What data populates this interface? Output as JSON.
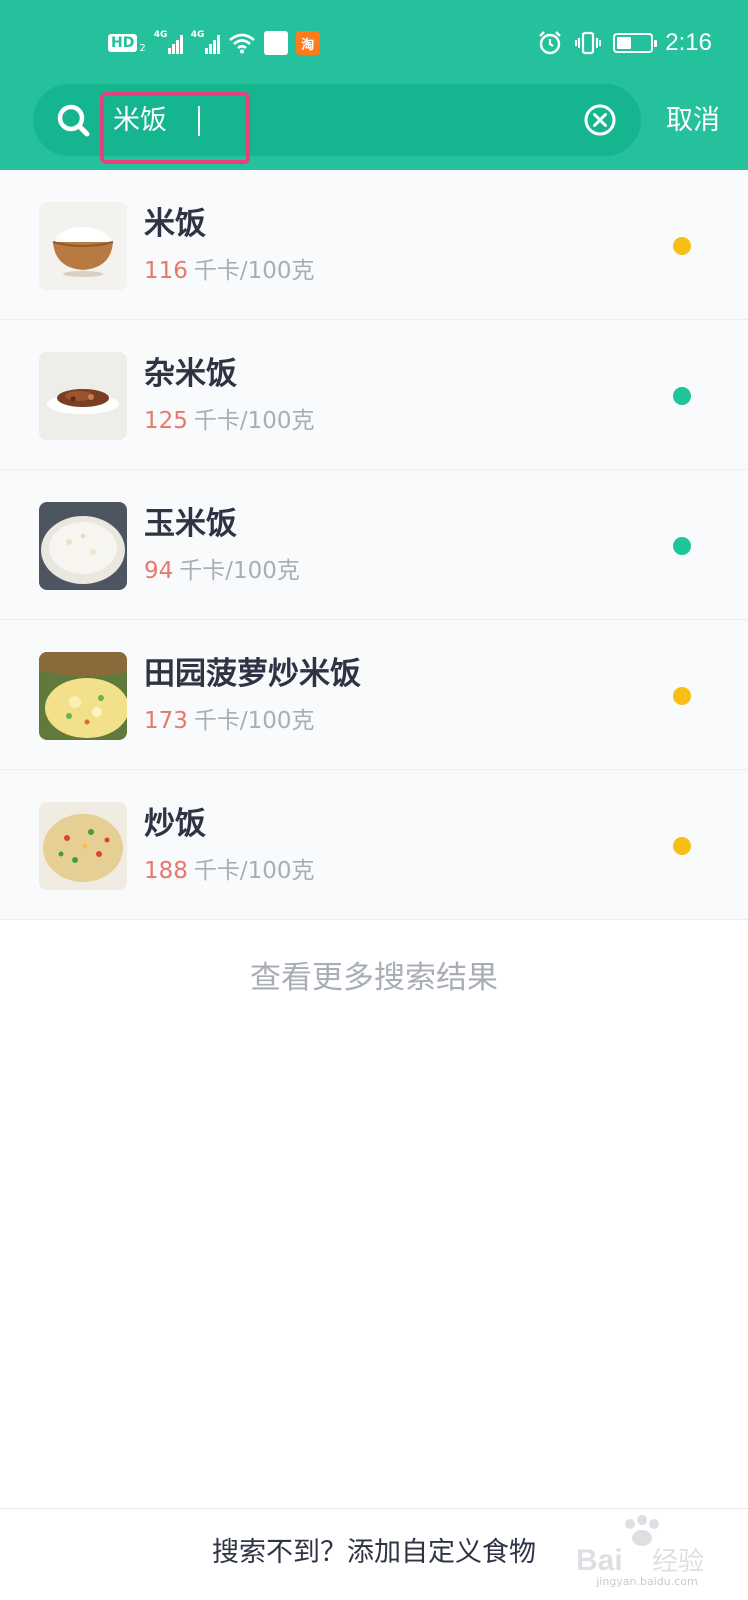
{
  "status_bar": {
    "hd_label": "HD",
    "hd_sub": "2",
    "network_1": "4G",
    "network_2": "4G",
    "app_icon_a": "",
    "app_icon_b": "淘",
    "time": "2:16"
  },
  "search": {
    "query": "米饭",
    "cancel_label": "取消"
  },
  "results": [
    {
      "name": "米饭",
      "kcal": "116",
      "unit": "千卡/100克",
      "dot_color": "#f7be16",
      "thumb": "rice-bowl"
    },
    {
      "name": "杂米饭",
      "kcal": "125",
      "unit": "千卡/100克",
      "dot_color": "#1ec59a",
      "thumb": "mixed-rice-plate"
    },
    {
      "name": "玉米饭",
      "kcal": "94",
      "unit": "千卡/100克",
      "dot_color": "#1ec59a",
      "thumb": "corn-rice"
    },
    {
      "name": "田园菠萝炒米饭",
      "kcal": "173",
      "unit": "千卡/100克",
      "dot_color": "#f7be16",
      "thumb": "pineapple-fried-rice"
    },
    {
      "name": "炒饭",
      "kcal": "188",
      "unit": "千卡/100克",
      "dot_color": "#f7be16",
      "thumb": "fried-rice"
    }
  ],
  "more_results_label": "查看更多搜索结果",
  "footer_label": "搜索不到？添加自定义食物",
  "watermark": {
    "brand": "Baidu 经验",
    "url": "jingyan.baidu.com"
  },
  "colors": {
    "header": "#25c19c",
    "search_box": "#14b58f",
    "highlight": "#e4417d",
    "kcal": "#e8786b"
  }
}
